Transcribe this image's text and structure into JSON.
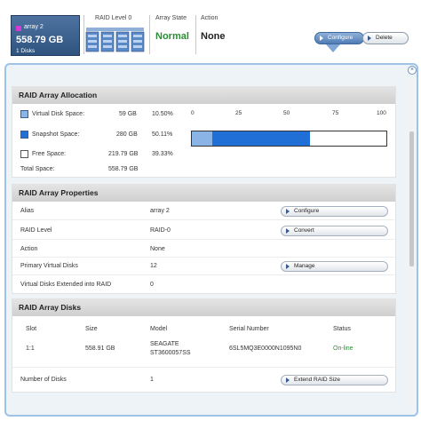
{
  "array": {
    "name": "array 2",
    "size": "558.79 GB",
    "disks": "1 Disks",
    "swatch_color": "#d43bd4"
  },
  "columns": {
    "raid_level": "RAID Level 0",
    "array_state": "Array State",
    "action": "Action"
  },
  "state_value": "Normal",
  "action_value": "None",
  "buttons": {
    "configure": "Configure",
    "delete": "Delete"
  },
  "allocation": {
    "title": "RAID Array Allocation",
    "rows": [
      {
        "label": "Virtual Disk Space:",
        "size": "59 GB",
        "percent": "10.50%",
        "color": "#8ab4e6"
      },
      {
        "label": "Snapshot Space:",
        "size": "280 GB",
        "percent": "50.11%",
        "color": "#1f6fd6"
      },
      {
        "label": "Free Space:",
        "size": "219.79 GB",
        "percent": "39.33%",
        "color": "#ffffff"
      }
    ],
    "total_label": "Total Space:",
    "total_value": "558.79 GB",
    "ticks": [
      "0",
      "25",
      "50",
      "75",
      "100"
    ],
    "fractions": {
      "virtual": 0.105,
      "snapshot": 0.5011
    }
  },
  "properties": {
    "title": "RAID Array Properties",
    "rows": [
      {
        "label": "Alias",
        "value": "array 2",
        "button": "Configure"
      },
      {
        "label": "RAID Level",
        "value": "RAID-0",
        "button": "Convert"
      },
      {
        "label": "Action",
        "value": "None",
        "button": ""
      },
      {
        "label": "Primary Virtual Disks",
        "value": "12",
        "button": "Manage"
      },
      {
        "label": "Virtual Disks Extended into RAID",
        "value": "0",
        "button": ""
      }
    ]
  },
  "disks": {
    "title": "RAID Array Disks",
    "headers": [
      "Slot",
      "Size",
      "Model",
      "Serial Number",
      "Status"
    ],
    "row": {
      "slot": "1:1",
      "size": "558.91 GB",
      "model_line1": "SEAGATE",
      "model_line2": "ST3600057SS",
      "serial": "6SL5MQ3E0000N1095N0",
      "status": "On-line",
      "status_color": "#2c8c35"
    },
    "count_label": "Number of Disks",
    "count_value": "1",
    "extend_button": "Extend RAID Size"
  },
  "accent_color": "#9ec3e8"
}
